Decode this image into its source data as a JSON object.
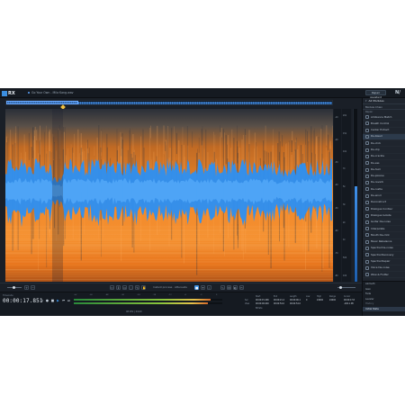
{
  "app": {
    "logo_text": "RX",
    "file_tab": "Go Your Own - Mila Kang.wav",
    "repair_assistant": "Repair Assistant",
    "ni_logo": "N/"
  },
  "modules": {
    "header": "All Modules",
    "chain": "Module Chain",
    "section": "Repair",
    "items": [
      "Ambience Match",
      "Breath Control",
      "Center Extract",
      "De-bleed",
      "De-click",
      "De-clip",
      "De-crackle",
      "De-ess",
      "De-hum",
      "De-plosive",
      "De-reverb",
      "De-rustle",
      "De-wind",
      "Deconstruct",
      "Dialogue Contour",
      "Dialogue Isolate",
      "Guitar De-noise",
      "Interpolate",
      "Mouth De-click",
      "Music Rebalance",
      "Spectral De-noise",
      "Spectral Recovery",
      "Spectral Repair",
      "Voice De-noise",
      "Wow & Flutter"
    ],
    "selected_index": 3,
    "footer": [
      "Azimuth",
      "Gain",
      "Fade",
      "Leveler"
    ],
    "history_label": "History",
    "history_item": "Initial State"
  },
  "toolbar": {
    "instant_process_label": "Instant process",
    "attenuate_label": "Attenuate"
  },
  "transport": {
    "timecode_label": "Timecode",
    "timecode": "00:00:17.851",
    "sample_info": "48 kHz | 24-bit",
    "level_scale": [
      "-Inf",
      "-60",
      "-48",
      "-36",
      "-24",
      "-18",
      "-12",
      "-6",
      "-3",
      "0"
    ],
    "level_fraction_left": 0.92,
    "level_fraction_right": 0.9
  },
  "selection": {
    "headers": [
      "Start",
      "End",
      "Length",
      "Low",
      "High",
      "Range",
      "Cursor"
    ],
    "row_labels": [
      "Sel",
      "View"
    ],
    "sel": [
      "00:00:15.206",
      "00:00:21.4",
      "00:00:06.1"
    ],
    "view": [
      "00:00:00.000",
      "00:02:54.0",
      "00:02:54.0"
    ],
    "freq": [
      "0",
      "24000",
      "24000"
    ],
    "cursor": [
      "00:00:17.8",
      "-100.1 dB"
    ],
    "bitrate_label": "Bitrate"
  },
  "rulers": {
    "db_labels": [
      "-10",
      "-20",
      "-30",
      "-40",
      "-50",
      "-60",
      "-70",
      "-80"
    ],
    "freq_labels": [
      "20k",
      "15k",
      "10k",
      "7k",
      "5k",
      "3k",
      "2k",
      "1k",
      "500",
      "100"
    ]
  },
  "meter_fraction": 0.55,
  "colors": {
    "accent": "#3c8fe0",
    "spectro_hot": "#f28a22",
    "wave": "#2f8ff0"
  }
}
